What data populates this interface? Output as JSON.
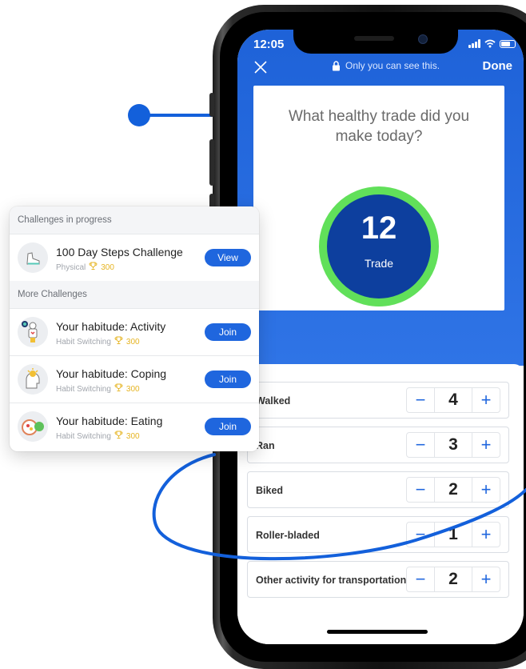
{
  "phone": {
    "status_time": "12:05",
    "privacy_notice": "Only you can see this.",
    "done_label": "Done",
    "question": "What healthy trade did you make today?",
    "trade_count": "12",
    "trade_label": "Trade",
    "activities": [
      {
        "label": "Walked",
        "value": "4"
      },
      {
        "label": "Ran",
        "value": "3"
      },
      {
        "label": "Biked",
        "value": "2"
      },
      {
        "label": "Roller-bladed",
        "value": "1"
      },
      {
        "label": "Other activity for transportation",
        "value": "2"
      }
    ],
    "minus_symbol": "−",
    "plus_symbol": "+"
  },
  "challenges": {
    "in_progress_header": "Challenges in progress",
    "more_header": "More Challenges",
    "in_progress": [
      {
        "title": "100 Day Steps Challenge",
        "category": "Physical",
        "points": "300",
        "button": "View",
        "icon": "sneaker-icon"
      }
    ],
    "more": [
      {
        "title": "Your habitude: Activity",
        "category": "Habit Switching",
        "points": "300",
        "button": "Join",
        "icon": "activity-figure-icon"
      },
      {
        "title": "Your habitude: Coping",
        "category": "Habit Switching",
        "points": "300",
        "button": "Join",
        "icon": "coping-head-icon"
      },
      {
        "title": "Your habitude: Eating",
        "category": "Habit Switching",
        "points": "300",
        "button": "Join",
        "icon": "food-plate-icon"
      }
    ]
  },
  "colors": {
    "primary_blue": "#1f66de",
    "ring_green": "#61e05a",
    "ring_fill": "#0d3f9e",
    "points_gold": "#e6b422"
  }
}
